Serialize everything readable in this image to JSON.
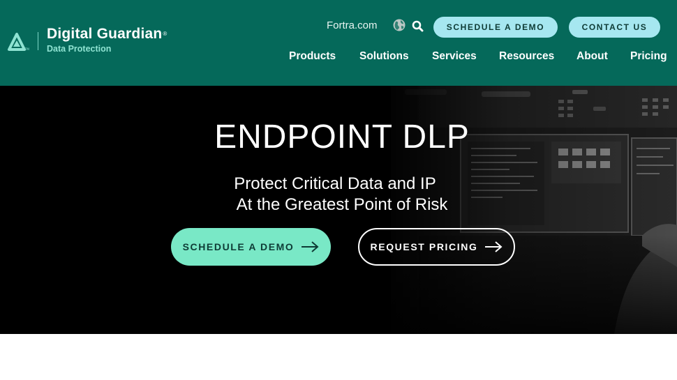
{
  "header": {
    "logo": {
      "title": "Digital Guardian",
      "registered": "®",
      "subtitle": "Data Protection"
    },
    "utility": {
      "fortra_link": "Fortra.com",
      "schedule_demo": "SCHEDULE A DEMO",
      "contact_us": "CONTACT US"
    },
    "nav": [
      "Products",
      "Solutions",
      "Services",
      "Resources",
      "About",
      "Pricing"
    ]
  },
  "hero": {
    "title": "ENDPOINT DLP",
    "subtitle_line1": "Protect Critical Data and IP",
    "subtitle_line2": "At the Greatest Point of Risk",
    "cta_demo": "SCHEDULE A DEMO",
    "cta_pricing": "REQUEST PRICING"
  },
  "colors": {
    "header_bg": "#05695a",
    "pill_bg": "#a6e7f0",
    "cta_green": "#79e8c6",
    "hero_bg": "#000000"
  },
  "icons": [
    "logo-triangle-icon",
    "globe-icon",
    "search-icon",
    "arrow-right-icon"
  ]
}
